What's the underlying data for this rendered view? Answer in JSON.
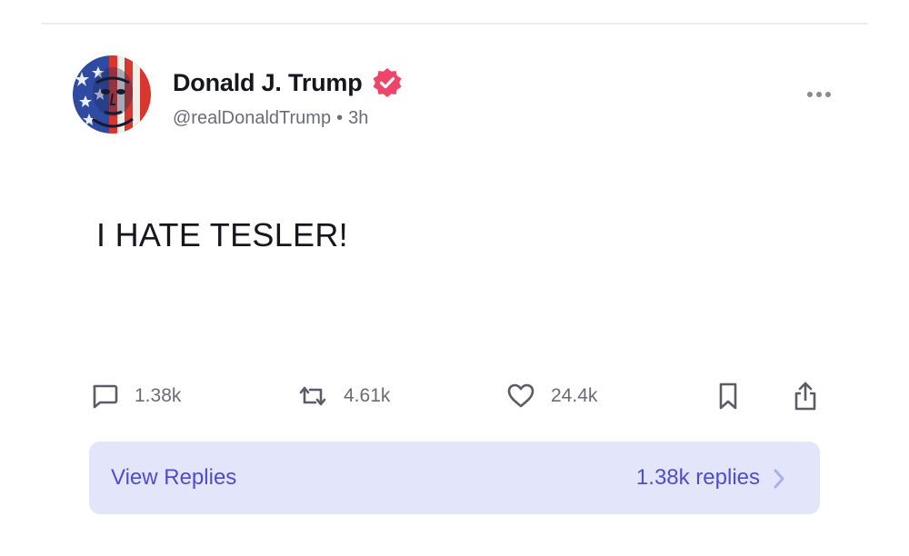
{
  "post": {
    "author": {
      "display_name": "Donald J. Trump",
      "handle": "@realDonaldTrump",
      "separator": "•",
      "time_ago": "3h",
      "verified": true,
      "avatar_icon": "avatar-image"
    },
    "text": "I HATE TESLER!",
    "more_icon": "more-horizontal-icon"
  },
  "actions": {
    "replies": {
      "icon": "comment-icon",
      "count": "1.38k"
    },
    "reposts": {
      "icon": "repost-icon",
      "count": "4.61k"
    },
    "likes": {
      "icon": "heart-icon",
      "count": "24.4k"
    },
    "bookmark": {
      "icon": "bookmark-icon"
    },
    "share": {
      "icon": "share-icon"
    }
  },
  "replies_bar": {
    "label": "View Replies",
    "count_label": "1.38k replies",
    "icon": "chevron-right-icon"
  },
  "colors": {
    "accent": "#4f4dc9",
    "replies_bar_bg": "#e3e6fb",
    "verified_badge": "#ef4568",
    "muted_text": "#6b6b78",
    "primary_text": "#16161d"
  }
}
